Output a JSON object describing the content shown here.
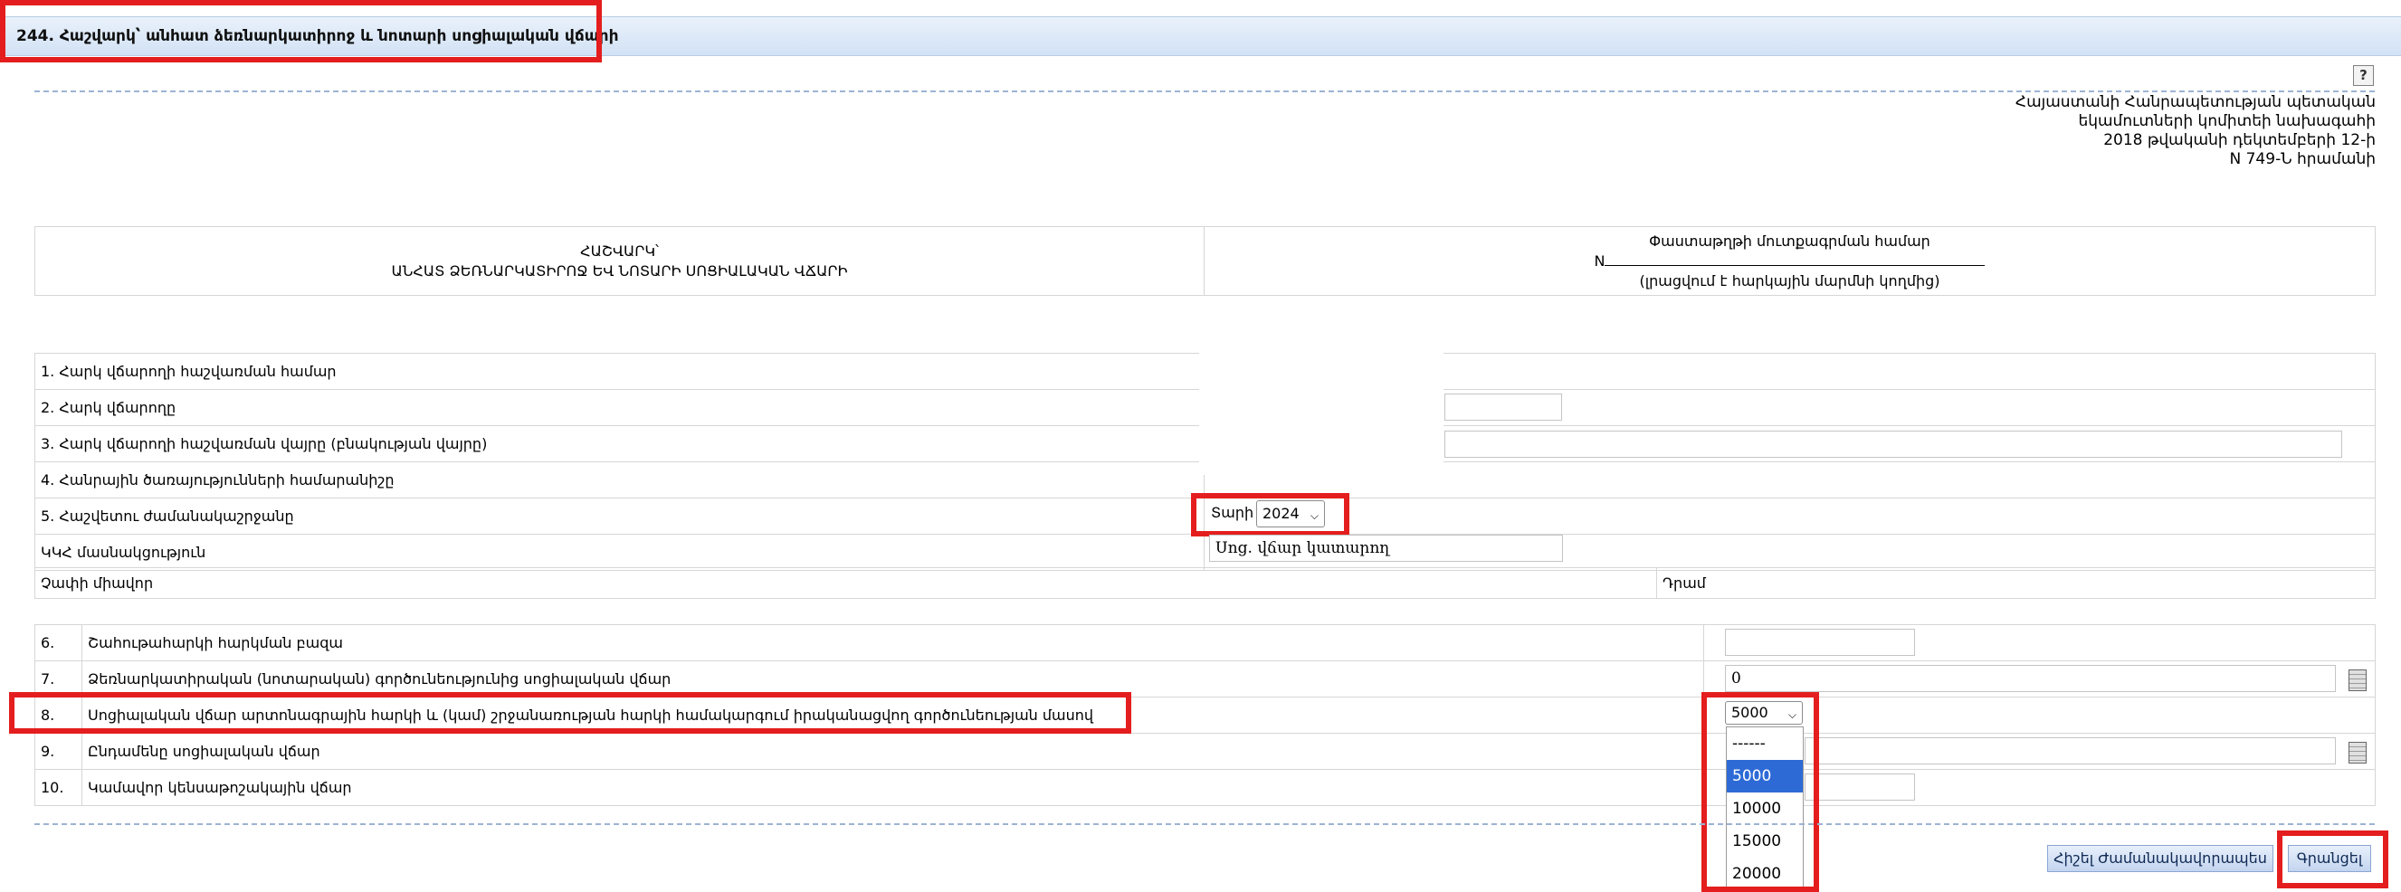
{
  "page": {
    "title": "244. Հաշվարկ՝ անհատ ձեռնարկատիրոջ և նոտարի սոցիալական վճարի"
  },
  "toolbar": {
    "help_icon": "?"
  },
  "decree": {
    "lines": [
      "Հայաստանի Հանրապետության պետական",
      "եկամուտների կոմիտեի նախագահի",
      "2018 թվականի դեկտեմբերի 12-ի",
      "N 749-Ն հրամանի"
    ]
  },
  "header": {
    "left_line1": "ՀԱՇՎԱՐԿ՝",
    "left_line2": "ԱՆՀԱՏ ՁԵՌՆԱՐԿԱՏԻՐՈՋ ԵՎ ՆՈՏԱՐԻ ՍՈՑԻԱԼԱԿԱՆ ՎՃԱՐԻ",
    "right_title": "Փաստաթղթի մուտքագրման համար",
    "right_n_prefix": "N",
    "right_note": "(լրացվում է հարկային մարմնի կողմից)"
  },
  "info": {
    "row1": "1. Հարկ վճարողի հաշվառման համար",
    "row2": "2. Հարկ վճարողը",
    "row3": "3. Հարկ վճարողի հաշվառման վայրը (բնակության վայրը)",
    "row4": "4. Հանրային ծառայությունների համարանիշը",
    "row5": "5. Հաշվետու ժամանակաշրջանը",
    "year_label": "Տարի",
    "year_value": "2024",
    "kkh_label": "ԿԿՀ մասնակցություն",
    "kkh_value": "Սոց. վճար կատարող",
    "unit_label": "Չափի միավոր",
    "unit_value": "Դրամ"
  },
  "items": [
    {
      "num": "6.",
      "label": "Շահութահարկի հարկման բազա",
      "value": ""
    },
    {
      "num": "7.",
      "label": "Ձեռնարկատիրական (նոտարական) գործունեությունից սոցիալական վճար",
      "value": "0"
    },
    {
      "num": "8.",
      "label": "Սոցիալական վճար արտոնագրային հարկի և (կամ) շրջանառության հարկի համակարգում իրականացվող գործունեության մասով",
      "value": "5000"
    },
    {
      "num": "9.",
      "label": "Ընդամենը սոցիալական վճար",
      "value": ""
    },
    {
      "num": "10.",
      "label": "Կամավոր կենսաթոշակային վճար",
      "value": ""
    }
  ],
  "dropdown": {
    "options": [
      "------",
      "5000",
      "10000",
      "15000",
      "20000"
    ],
    "selected": "5000"
  },
  "buttons": {
    "schedule": "Հիշել Ժամանակավորապես",
    "save": "Գրանցել"
  },
  "colors": {
    "highlight": "#e41e1e",
    "selected_option": "#2d6ad6",
    "title_bar": "#d2e2f5"
  }
}
